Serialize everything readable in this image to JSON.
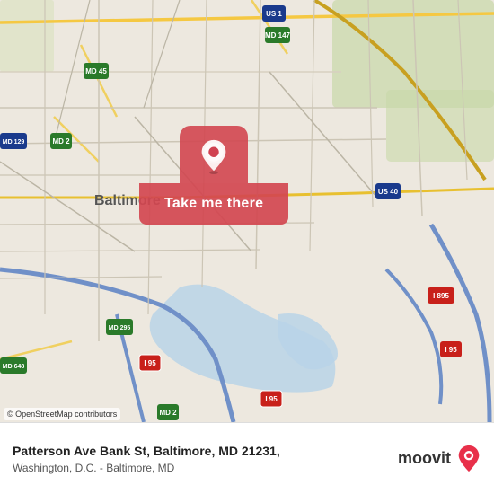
{
  "map": {
    "alt": "Map of Baltimore, MD area",
    "center_lat": 39.28,
    "center_lng": -76.6
  },
  "button": {
    "label": "Take me there"
  },
  "info_bar": {
    "address": "Patterson Ave Bank St, Baltimore, MD 21231,",
    "sub_address": "Washington, D.C. - Baltimore, MD",
    "logo_text": "moovit",
    "osm_attribution": "© OpenStreetMap contributors"
  }
}
